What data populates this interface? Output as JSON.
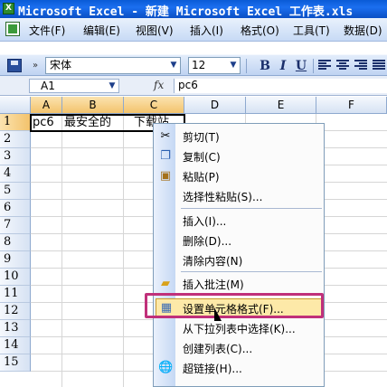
{
  "window": {
    "title": "Microsoft Excel - 新建 Microsoft Excel 工作表.xls"
  },
  "menubar": {
    "items": [
      {
        "label": "文件(F)"
      },
      {
        "label": "编辑(E)"
      },
      {
        "label": "视图(V)"
      },
      {
        "label": "插入(I)"
      },
      {
        "label": "格式(O)"
      },
      {
        "label": "工具(T)"
      },
      {
        "label": "数据(D)"
      }
    ]
  },
  "toolbar": {
    "font_name": "宋体",
    "font_size": "12",
    "bold_label": "B",
    "italic_label": "I",
    "underline_label": "U"
  },
  "formula_bar": {
    "name_box": "A1",
    "fx_label": "fx",
    "content": "pc6"
  },
  "grid": {
    "columns": [
      "A",
      "B",
      "C",
      "D",
      "E",
      "F"
    ],
    "rows": [
      "1",
      "2",
      "3",
      "4",
      "5",
      "6",
      "7",
      "8",
      "9",
      "10",
      "11",
      "12",
      "13",
      "14",
      "15"
    ],
    "cells": {
      "A1": "pc6",
      "B1": "最安全的",
      "C1": "下载站"
    }
  },
  "context_menu": {
    "items": [
      {
        "label": "剪切(T)",
        "icon": "scissors-icon"
      },
      {
        "label": "复制(C)",
        "icon": "copy-icon"
      },
      {
        "label": "粘贴(P)",
        "icon": "paste-icon"
      },
      {
        "label": "选择性粘贴(S)...",
        "icon": ""
      },
      {
        "label": "插入(I)...",
        "icon": ""
      },
      {
        "label": "删除(D)...",
        "icon": ""
      },
      {
        "label": "清除内容(N)",
        "icon": ""
      },
      {
        "label": "插入批注(M)",
        "icon": "comment-icon"
      },
      {
        "label": "设置单元格格式(F)...",
        "icon": "format-cells-icon",
        "highlighted": true
      },
      {
        "label": "从下拉列表中选择(K)...",
        "icon": ""
      },
      {
        "label": "创建列表(C)...",
        "icon": ""
      },
      {
        "label": "超链接(H)...",
        "icon": "hyperlink-icon"
      }
    ]
  },
  "colors": {
    "highlight_frame": "#c0307a",
    "menu_highlight": "#fde9a8",
    "title_bar": "#0a5bd6"
  }
}
